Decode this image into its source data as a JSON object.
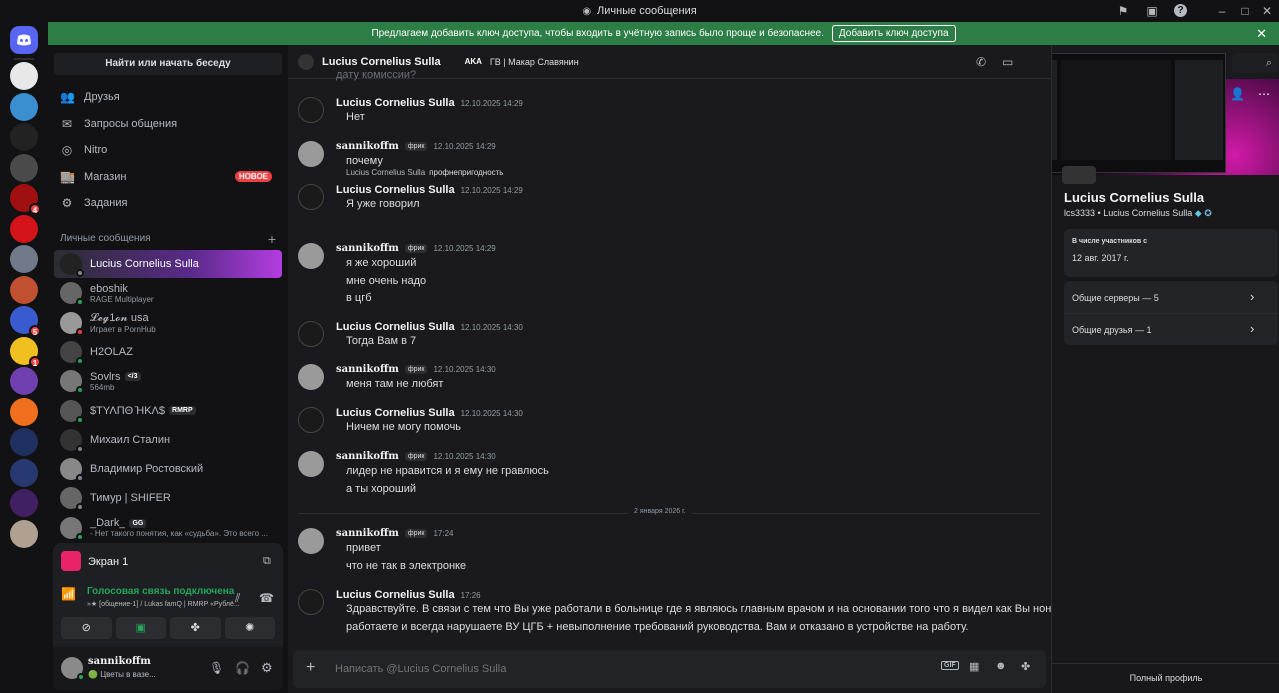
{
  "window": {
    "title": "Личные сообщения"
  },
  "banner": {
    "text": "Предлагаем добавить ключ доступа, чтобы входить в учётную запись было проще и безопаснее.",
    "button": "Добавить ключ доступа"
  },
  "servers": [
    {
      "badge": ""
    },
    {
      "badge": ""
    },
    {
      "badge": ""
    },
    {
      "badge": ""
    },
    {
      "badge": "4"
    },
    {
      "badge": ""
    },
    {
      "badge": ""
    },
    {
      "badge": ""
    },
    {
      "badge": "5"
    },
    {
      "badge": "1"
    },
    {
      "badge": ""
    },
    {
      "badge": ""
    },
    {
      "badge": ""
    },
    {
      "badge": ""
    },
    {
      "badge": ""
    },
    {
      "badge": ""
    }
  ],
  "sidebar": {
    "search": "Найти или начать беседу",
    "nav": [
      {
        "label": "Друзья",
        "icon": "friends-icon"
      },
      {
        "label": "Запросы общения",
        "icon": "mail-icon"
      },
      {
        "label": "Nitro",
        "icon": "nitro-icon"
      },
      {
        "label": "Магазин",
        "icon": "shop-icon",
        "badge": "НОВОЕ"
      },
      {
        "label": "Задания",
        "icon": "quests-icon"
      }
    ],
    "dm_header": "Личные сообщения",
    "dms": [
      {
        "name": "Lucius Cornelius Sulla",
        "sub": ""
      },
      {
        "name": "eboshik",
        "sub": "RAGE Multiplayer"
      },
      {
        "name": "𝓛𝓮𝓰1𝓸𝓷 usa",
        "sub": "Играет в PornHub"
      },
      {
        "name": "H2OLAZ",
        "sub": ""
      },
      {
        "name": "Sovlrs",
        "tag": "</3",
        "sub": "564mb"
      },
      {
        "name": "$ΤΥΛΠΘ ̄HΚΛ$",
        "tag": "RMRP",
        "sub": ""
      },
      {
        "name": "Михаил Сталин",
        "sub": ""
      },
      {
        "name": "Владимир Ростовский",
        "sub": ""
      },
      {
        "name": "Тимур | SHIFER",
        "sub": ""
      },
      {
        "name": "_Dark_",
        "tag": "GG",
        "sub": "- Нет такого понятия, как «судьба». Это всего ..."
      }
    ]
  },
  "voice": {
    "screen_title": "Экран 1",
    "connected": "Голосовая связь подключена",
    "channel": "[общение-1] / Lukas famQ | RMRP «Рублё...",
    "user": "sannikoffm",
    "user_status": "Цветы в вазе..."
  },
  "chat": {
    "header_name": "Lucius Cornelius Sulla",
    "aka_label": "AKA",
    "aka_value": "ГВ | Макар Славянин",
    "top_cut": "дату комиссии?",
    "messages": [
      {
        "author": "Lucius Cornelius Sulla",
        "time": "12.10.2025 14:29",
        "lines": [
          "Нет"
        ]
      },
      {
        "author": "sannikoffm",
        "tag": "фрик",
        "time": "12.10.2025 14:29",
        "lines": [
          "почему"
        ]
      },
      {
        "reply_author": "Lucius Cornelius Sulla",
        "reply_text": "профнепригодность",
        "author": "Lucius Cornelius Sulla",
        "time": "12.10.2025 14:29",
        "lines": [
          "Я уже говорил"
        ]
      },
      {
        "author": "sannikoffm",
        "tag": "фрик",
        "time": "12.10.2025 14:29",
        "lines": [
          "я же хороший",
          "мне очень надо",
          "в цгб"
        ]
      },
      {
        "author": "Lucius Cornelius Sulla",
        "time": "12.10.2025 14:30",
        "lines": [
          "Тогда Вам в 7"
        ]
      },
      {
        "author": "sannikoffm",
        "tag": "фрик",
        "time": "12.10.2025 14:30",
        "lines": [
          "меня там не любят"
        ]
      },
      {
        "author": "Lucius Cornelius Sulla",
        "time": "12.10.2025 14:30",
        "lines": [
          "Ничем не могу помочь"
        ]
      },
      {
        "author": "sannikoffm",
        "tag": "фрик",
        "time": "12.10.2025 14:30",
        "lines": [
          "лидер не нравится и я ему не гравлюсь",
          "а ты хороший"
        ]
      },
      {
        "author": "sannikoffm",
        "tag": "фрик",
        "time": "17:24",
        "lines": [
          "привет",
          "что не так в электронке"
        ]
      },
      {
        "author": "Lucius Cornelius Sulla",
        "time": "17:26",
        "lines": [
          "Здравствуйте. В связи с тем что Вы уже работали в больнице где я являюсь главным врачом и на основании того что я видел как Вы нон-рп",
          "работаете и всегда нарушаете ВУ ЦГБ + невыполнение требований руководства. Вам и отказано в устройстве на работу."
        ]
      }
    ],
    "date_divider": "2 января 2026 г.",
    "composer_placeholder": "Написать @Lucius Cornelius Sulla"
  },
  "profile": {
    "name": "Lucius Cornelius Sulla",
    "username": "lcs3333",
    "display": "Lucius Cornelius Sulla",
    "member_since_label": "В числе участников с",
    "member_since": "12 авг. 2017 г.",
    "mutual_servers": "Общие серверы — 5",
    "mutual_friends": "Общие друзья — 1",
    "full_profile": "Полный профиль"
  }
}
